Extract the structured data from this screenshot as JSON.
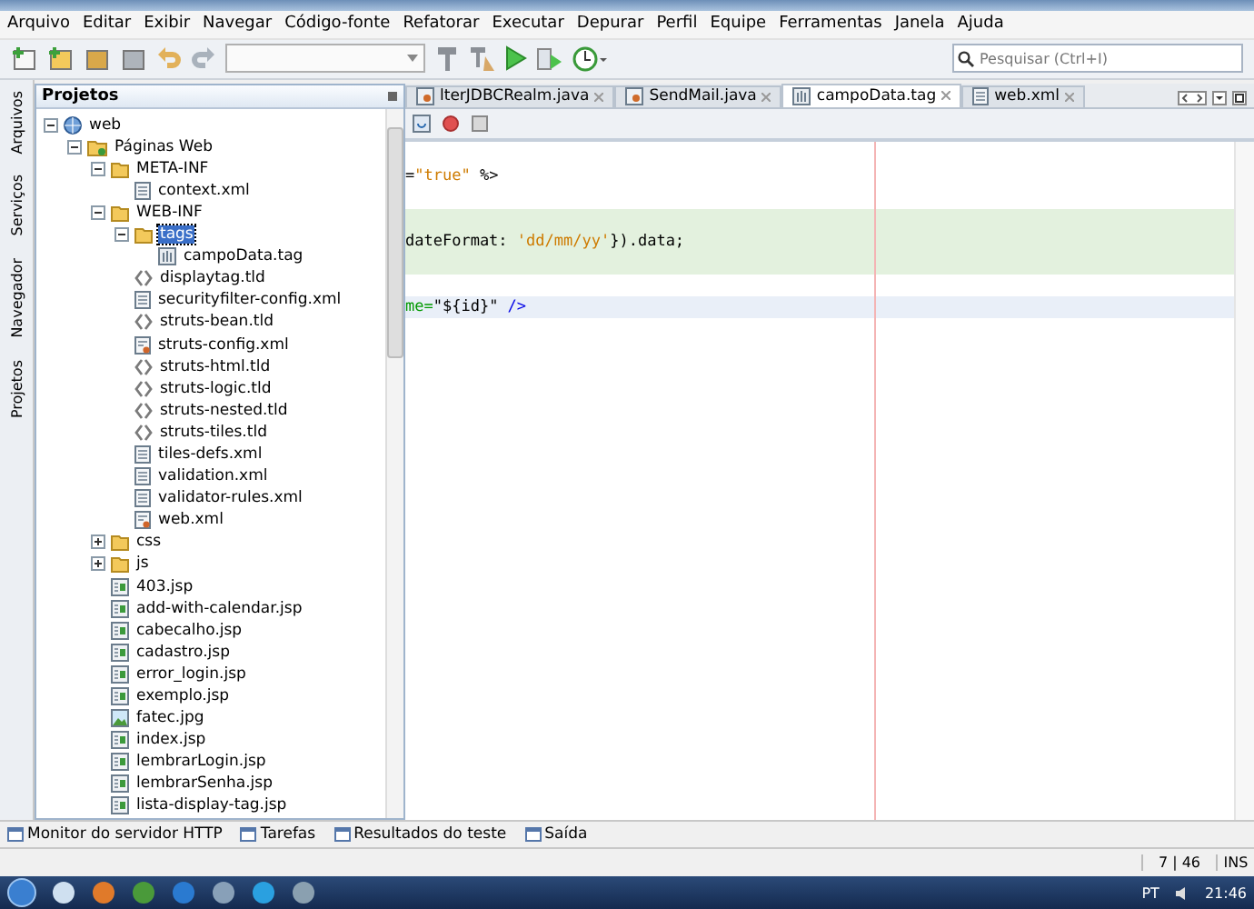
{
  "menu": [
    "Arquivo",
    "Editar",
    "Exibir",
    "Navegar",
    "Código-fonte",
    "Refatorar",
    "Executar",
    "Depurar",
    "Perfil",
    "Equipe",
    "Ferramentas",
    "Janela",
    "Ajuda"
  ],
  "search": {
    "placeholder": "Pesquisar (Ctrl+I)"
  },
  "side_tabs": [
    "Arquivos",
    "Serviços",
    "Navegador",
    "Projetos"
  ],
  "projects_panel": {
    "title": "Projetos",
    "tree": [
      {
        "label": "web",
        "kind": "globe",
        "expanded": true,
        "selected": false,
        "children": [
          {
            "label": "Páginas Web",
            "kind": "webfolder",
            "expanded": true,
            "selected": false,
            "children": [
              {
                "label": "META-INF",
                "kind": "folder",
                "expanded": true,
                "selected": false,
                "children": [
                  {
                    "label": "context.xml",
                    "kind": "xml",
                    "selected": false
                  }
                ]
              },
              {
                "label": "WEB-INF",
                "kind": "folder",
                "expanded": true,
                "selected": false,
                "children": [
                  {
                    "label": "tags",
                    "kind": "folder",
                    "expanded": true,
                    "selected": true,
                    "children": [
                      {
                        "label": "campoData.tag",
                        "kind": "tag",
                        "selected": false
                      }
                    ]
                  },
                  {
                    "label": "displaytag.tld",
                    "kind": "tld",
                    "selected": false
                  },
                  {
                    "label": "securityfilter-config.xml",
                    "kind": "xml",
                    "selected": false
                  },
                  {
                    "label": "struts-bean.tld",
                    "kind": "tld",
                    "selected": false
                  },
                  {
                    "label": "struts-config.xml",
                    "kind": "config",
                    "selected": false
                  },
                  {
                    "label": "struts-html.tld",
                    "kind": "tld",
                    "selected": false
                  },
                  {
                    "label": "struts-logic.tld",
                    "kind": "tld",
                    "selected": false
                  },
                  {
                    "label": "struts-nested.tld",
                    "kind": "tld",
                    "selected": false
                  },
                  {
                    "label": "struts-tiles.tld",
                    "kind": "tld",
                    "selected": false
                  },
                  {
                    "label": "tiles-defs.xml",
                    "kind": "xml",
                    "selected": false
                  },
                  {
                    "label": "validation.xml",
                    "kind": "xml",
                    "selected": false
                  },
                  {
                    "label": "validator-rules.xml",
                    "kind": "xml",
                    "selected": false
                  },
                  {
                    "label": "web.xml",
                    "kind": "config",
                    "selected": false
                  }
                ]
              },
              {
                "label": "css",
                "kind": "folder",
                "expanded": false,
                "selected": false
              },
              {
                "label": "js",
                "kind": "folder",
                "expanded": false,
                "selected": false
              },
              {
                "label": "403.jsp",
                "kind": "jsp",
                "selected": false
              },
              {
                "label": "add-with-calendar.jsp",
                "kind": "jsp",
                "selected": false
              },
              {
                "label": "cabecalho.jsp",
                "kind": "jsp",
                "selected": false
              },
              {
                "label": "cadastro.jsp",
                "kind": "jsp",
                "selected": false
              },
              {
                "label": "error_login.jsp",
                "kind": "jsp",
                "selected": false
              },
              {
                "label": "exemplo.jsp",
                "kind": "jsp",
                "selected": false
              },
              {
                "label": "fatec.jpg",
                "kind": "image",
                "selected": false
              },
              {
                "label": "index.jsp",
                "kind": "jsp",
                "selected": false
              },
              {
                "label": "lembrarLogin.jsp",
                "kind": "jsp",
                "selected": false
              },
              {
                "label": "lembrarSenha.jsp",
                "kind": "jsp",
                "selected": false
              },
              {
                "label": "lista-display-tag.jsp",
                "kind": "jsp",
                "selected": false
              }
            ]
          }
        ]
      }
    ]
  },
  "editor_tabs": [
    {
      "label": "lterJDBCRealm.java",
      "kind": "java",
      "selected": false
    },
    {
      "label": "SendMail.java",
      "kind": "java",
      "selected": false
    },
    {
      "label": "campoData.tag",
      "kind": "tag",
      "selected": true
    },
    {
      "label": "web.xml",
      "kind": "xml",
      "selected": false
    }
  ],
  "code_lines": [
    {
      "embedded": false,
      "current": false,
      "tokens": [
        {
          "kind": "plain",
          "text": "="
        },
        {
          "kind": "string",
          "text": "\"true\""
        },
        {
          "kind": "plain",
          "text": " %>"
        }
      ]
    },
    {
      "embedded": false,
      "current": false
    },
    {
      "embedded": true,
      "current": false
    },
    {
      "embedded": true,
      "current": false,
      "tokens": [
        {
          "kind": "plain",
          "text": "dateFormat: "
        },
        {
          "kind": "string",
          "text": "'dd/mm/yy'"
        },
        {
          "kind": "plain",
          "text": "}).data;"
        }
      ]
    },
    {
      "embedded": true,
      "current": false
    },
    {
      "embedded": false,
      "current": false
    },
    {
      "embedded": false,
      "current": true,
      "tokens": [
        {
          "kind": "attr",
          "text": "me="
        },
        {
          "kind": "plain",
          "text": "\"${id}\""
        },
        {
          "kind": "tag",
          "text": " />"
        }
      ]
    }
  ],
  "bottom_tabs": [
    "Monitor do servidor HTTP",
    "Tarefas",
    "Resultados do teste",
    "Saída"
  ],
  "status_bar": {
    "position": "7 | 46",
    "mode": "INS"
  },
  "taskbar": {
    "language": "PT",
    "time": "21:46"
  }
}
